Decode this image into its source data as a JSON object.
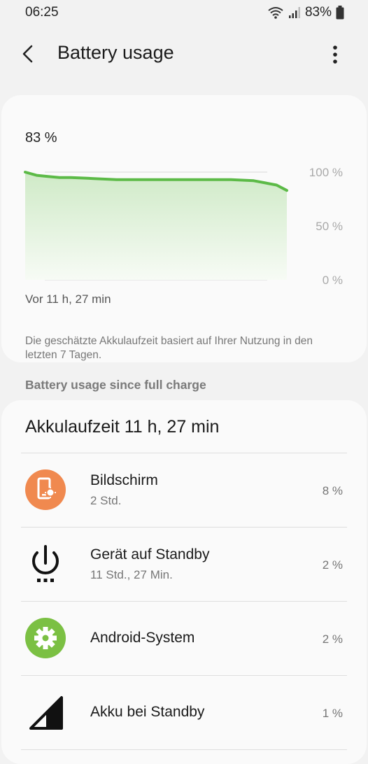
{
  "status_bar": {
    "time": "06:25",
    "battery_pct": "83%"
  },
  "appbar": {
    "title": "Battery usage"
  },
  "summary_card": {
    "current_pct": "83 %",
    "since_label": "Vor 11 h, 27 min",
    "note": "Die geschätzte Akkulaufzeit basiert auf Ihrer Nutzung in den letzten 7 Tagen."
  },
  "chart_data": {
    "type": "area",
    "title": "",
    "xlabel": "",
    "ylabel": "",
    "x_unit": "hours elapsed",
    "x": [
      0,
      0.5,
      1,
      1.5,
      2,
      3,
      4,
      5,
      6,
      7,
      8,
      9,
      10,
      10.5,
      11,
      11.45
    ],
    "values": [
      100,
      97,
      96,
      95,
      95,
      94,
      93,
      93,
      93,
      93,
      93,
      93,
      92,
      90,
      88,
      83
    ],
    "ylim": [
      0,
      100
    ],
    "ytick_labels": [
      "100 %",
      "50 %",
      "0 %"
    ],
    "grid": true,
    "line_color": "#5cba47",
    "fill_color": "#d9f0d4"
  },
  "section_header": "Battery usage since full charge",
  "usage": {
    "total": "Akkulaufzeit 11 h, 27 min",
    "items": [
      {
        "name": "Bildschirm",
        "sub": "2 Std.",
        "pct": "8 %",
        "icon": "screen-brightness-icon",
        "color": "#f0894f"
      },
      {
        "name": "Gerät auf Standby",
        "sub": "11 Std., 27 Min.",
        "pct": "2 %",
        "icon": "power-standby-icon",
        "color": "#000000"
      },
      {
        "name": "Android-System",
        "sub": "",
        "pct": "2 %",
        "icon": "gear-icon",
        "color": "#7bc043"
      },
      {
        "name": "Akku bei Standby",
        "sub": "",
        "pct": "1 %",
        "icon": "signal-icon",
        "color": "#000000"
      }
    ]
  }
}
